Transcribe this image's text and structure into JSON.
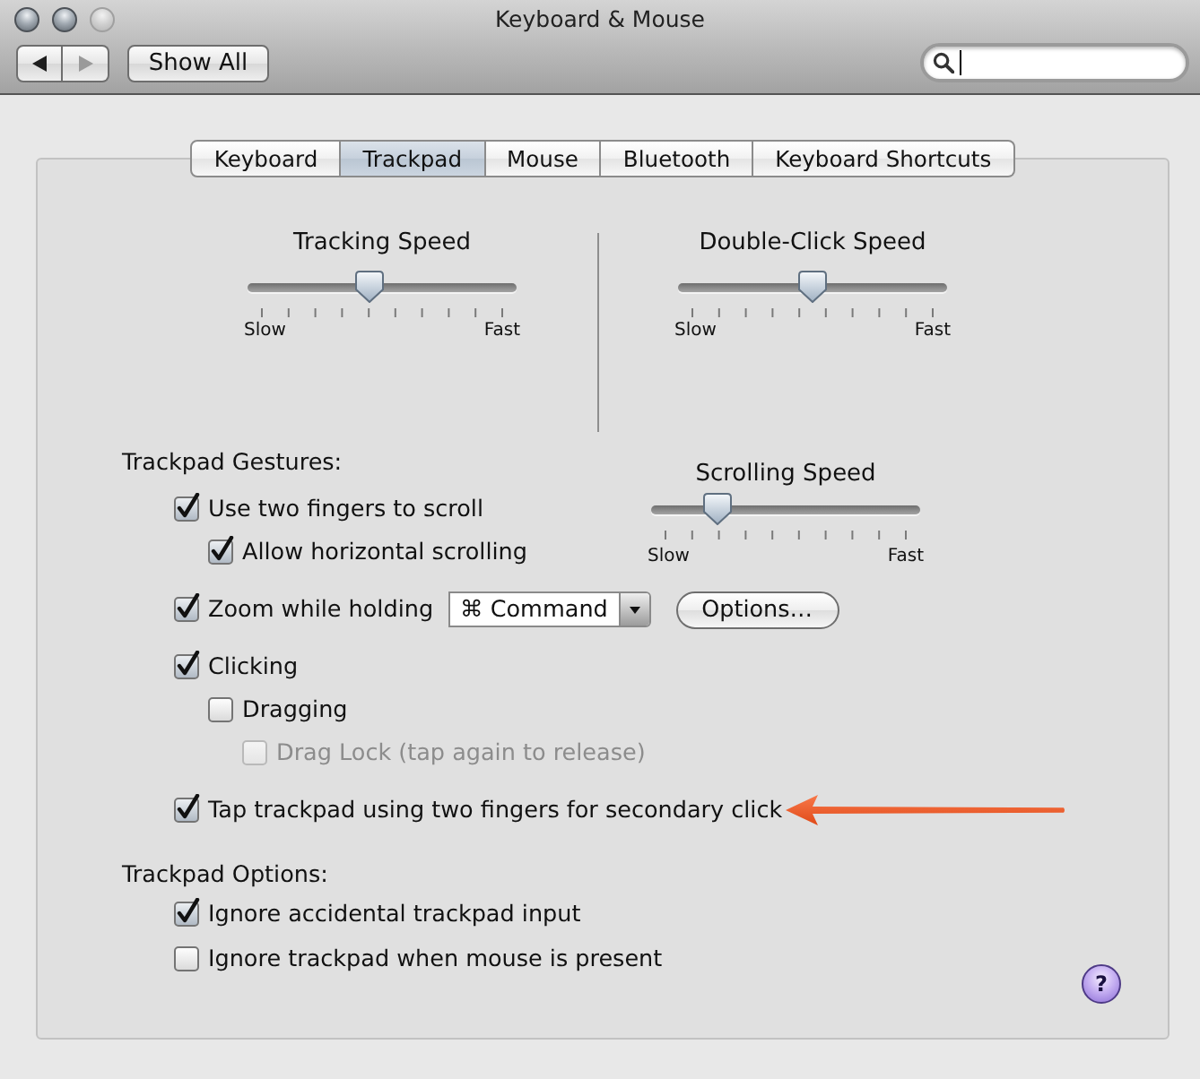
{
  "window": {
    "title": "Keyboard & Mouse",
    "controls": [
      {
        "kind": "close",
        "disabled": false
      },
      {
        "kind": "minimize",
        "disabled": false
      },
      {
        "kind": "zoom",
        "disabled": true
      }
    ]
  },
  "toolbar": {
    "nav": [
      {
        "kind": "back",
        "disabled": false
      },
      {
        "kind": "forward",
        "disabled": true
      }
    ],
    "show_all": "Show All",
    "search": {
      "focused": true
    }
  },
  "tabs": [
    {
      "label": "Keyboard",
      "selected": false
    },
    {
      "label": "Trackpad",
      "selected": true
    },
    {
      "label": "Mouse",
      "selected": false
    },
    {
      "label": "Bluetooth",
      "selected": false
    },
    {
      "label": "Keyboard Shortcuts",
      "selected": false
    }
  ],
  "speed_sliders": [
    {
      "label": "Tracking Speed",
      "level": 0.45,
      "min_label": "Slow",
      "max_label": "Fast"
    },
    {
      "label": "Double-Click Speed",
      "level": 0.5,
      "min_label": "Slow",
      "max_label": "Fast"
    }
  ],
  "gestures": {
    "heading": "Trackpad Gestures:",
    "scrolling_speed": {
      "label": "Scrolling Speed",
      "level": 0.22,
      "min_label": "Slow",
      "max_label": "Fast"
    },
    "items": [
      {
        "label": "Use two fingers to scroll",
        "checked": true,
        "disabled": false,
        "marked": false,
        "children": [
          {
            "label": "Allow horizontal scrolling",
            "checked": true,
            "disabled": false,
            "marked": false
          }
        ]
      },
      {
        "label": "Zoom while holding",
        "checked": true,
        "disabled": false,
        "marked": false,
        "popup": {
          "value": "⌘ Command"
        },
        "button": "Options…"
      },
      {
        "label": "Clicking",
        "checked": true,
        "disabled": false,
        "marked": false,
        "children": [
          {
            "label": "Dragging",
            "checked": false,
            "disabled": false,
            "marked": false,
            "children": [
              {
                "label": "Drag Lock (tap again to release)",
                "checked": false,
                "disabled": true,
                "marked": false
              }
            ]
          }
        ]
      },
      {
        "label": "Tap trackpad using two fingers for secondary click",
        "checked": true,
        "disabled": false,
        "marked": true
      }
    ]
  },
  "options": {
    "heading": "Trackpad Options:",
    "items": [
      {
        "label": "Ignore accidental trackpad input",
        "checked": true
      },
      {
        "label": "Ignore trackpad when mouse is present",
        "checked": false
      }
    ]
  },
  "help_button": "?"
}
